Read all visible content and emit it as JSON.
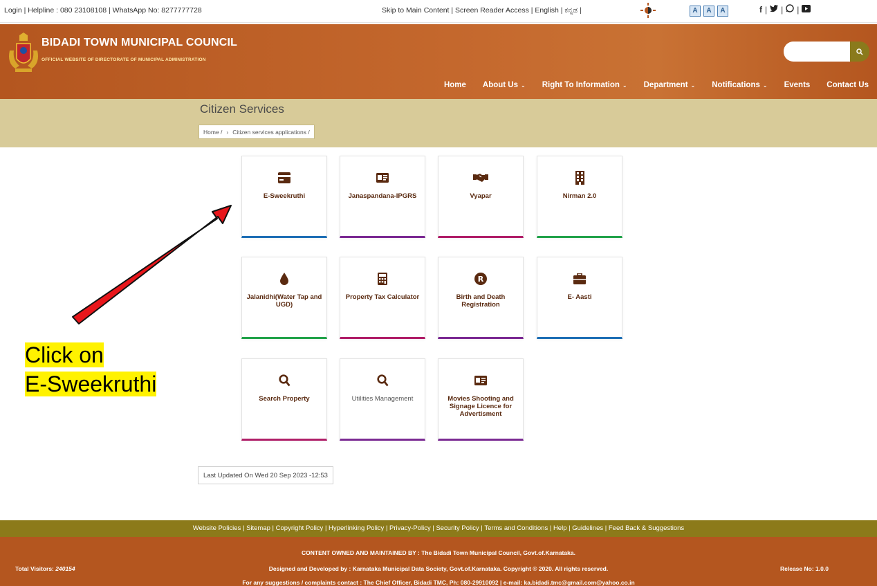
{
  "topbar": {
    "left_text": "Login | Helpline : 080 23108108 | WhatsApp No: 8277777728",
    "mid_text": "Skip to Main Content | Screen Reader Access | English | ಕನ್ನಡ |",
    "font_buttons": [
      "A",
      "A",
      "A"
    ],
    "social_sep": "|"
  },
  "header": {
    "title": "BIDADI TOWN MUNICIPAL COUNCIL",
    "subtitle": "OFFICIAL WEBSITE OF DIRECTORATE OF MUNICIPAL ADMINISTRATION",
    "search_placeholder": ""
  },
  "nav": {
    "home": "Home",
    "about": "About Us",
    "rti": "Right To Information",
    "department": "Department",
    "notifications": "Notifications",
    "events": "Events",
    "contact": "Contact Us"
  },
  "page": {
    "title": "Citizen Services",
    "breadcrumb_home": "Home /",
    "breadcrumb_sep": "›",
    "breadcrumb_current": "Citizen services applications /"
  },
  "services": [
    {
      "label": "E-Sweekruthi",
      "icon": "card-icon",
      "color": "#1f6fb5"
    },
    {
      "label": "Janaspandana-IPGRS",
      "icon": "id-card-icon",
      "color": "#7b2a93"
    },
    {
      "label": "Vyapar",
      "icon": "handshake-icon",
      "color": "#b01e68"
    },
    {
      "label": "Nirman 2.0",
      "icon": "building-icon",
      "color": "#22a34a"
    },
    {
      "label": "Jalanidhi(Water Tap and UGD)",
      "icon": "water-drop-icon",
      "color": "#22a34a"
    },
    {
      "label": "Property Tax Calculator",
      "icon": "calculator-icon",
      "color": "#b01e68"
    },
    {
      "label": "Birth and Death Registration",
      "icon": "registered-icon",
      "color": "#7b2a93"
    },
    {
      "label": "E- Aasti",
      "icon": "briefcase-icon",
      "color": "#1f6fb5"
    },
    {
      "label": "Search Property",
      "icon": "search-icon",
      "color": "#b01e68"
    },
    {
      "label": "Utilities Management",
      "icon": "search-icon",
      "color": "#7b2a93"
    },
    {
      "label": "Movies Shooting and Signage Licence for Advertisment",
      "icon": "id-card-icon",
      "color": "#7b2a93"
    }
  ],
  "last_updated": "Last Updated On Wed 20 Sep 2023 -12:53",
  "annotation": {
    "line1": "Click on",
    "line2": "E-Sweekruthi",
    "arrow_color": "#e8161b"
  },
  "footer": {
    "links": "Website Policies | Sitemap | Copyright Policy | Hyperlinking Policy | Privacy-Policy | Security Policy | Terms and Conditions | Help | Guidelines | Feed Back & Suggestions",
    "visitors_label": "Total Visitors:",
    "visitors_count": "240154",
    "line1": "CONTENT OWNED AND MAINTAINED BY : The Bidadi Town Municipal Council, Govt.of.Karnataka.",
    "line2": "Designed and Developed by : Karnataka Municipal Data Society, Govt.of.Karnataka. Copyright © 2020. All rights reserved.",
    "line3": "For any suggestions / complaints contact : The Chief Officer, Bidadi TMC, Ph: 080-29910092 | e-mail: ka.bidadi.tmc@gmail.com@yahoo.co.in",
    "release": "Release No: 1.0.0"
  },
  "colors": {
    "header_bg": "#b4561f",
    "band_bg": "#d8cb99",
    "footer_links_bg": "#8c7a1a",
    "card_text": "#5a2a10"
  }
}
